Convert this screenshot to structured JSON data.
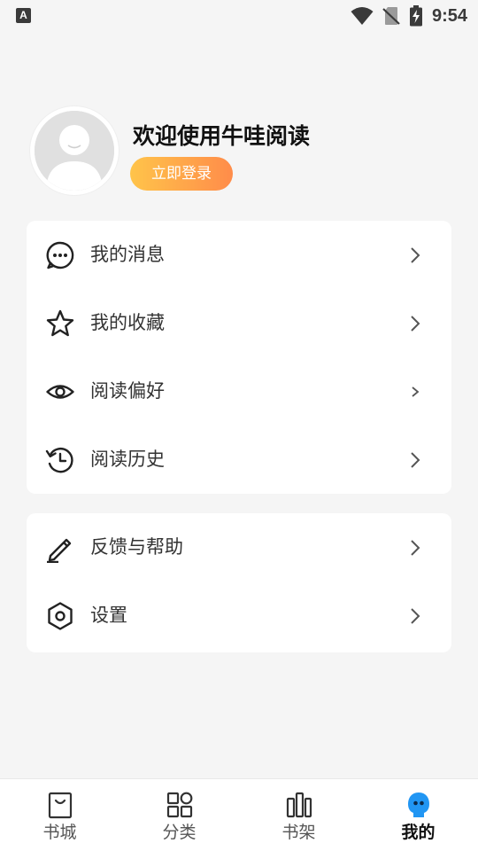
{
  "status_bar": {
    "notification_icon": "A",
    "time": "9:54",
    "icons": [
      "wifi-icon",
      "no-sim-icon",
      "battery-charging-icon"
    ]
  },
  "profile": {
    "avatar_icon": "default-avatar-icon",
    "welcome_text": "欢迎使用牛哇阅读",
    "login_label": "立即登录",
    "login_gradient": [
      "#ffc44a",
      "#ff8c4a"
    ]
  },
  "menu_group_1": [
    {
      "label": "我的消息",
      "icon": "chat-bubble-icon"
    },
    {
      "label": "我的收藏",
      "icon": "star-icon"
    },
    {
      "label": "阅读偏好",
      "icon": "eye-icon"
    },
    {
      "label": "阅读历史",
      "icon": "history-icon"
    }
  ],
  "menu_group_2": [
    {
      "label": "反馈与帮助",
      "icon": "pencil-icon"
    },
    {
      "label": "设置",
      "icon": "settings-hexagon-icon"
    }
  ],
  "bottom_nav": [
    {
      "label": "书城",
      "icon": "bookstore-icon",
      "active": false
    },
    {
      "label": "分类",
      "icon": "category-grid-icon",
      "active": false
    },
    {
      "label": "书架",
      "icon": "bookshelf-icon",
      "active": false
    },
    {
      "label": "我的",
      "icon": "profile-mascot-icon",
      "active": true
    }
  ],
  "colors": {
    "background": "#f5f5f5",
    "card": "#ffffff",
    "accent_blue": "#2196f3",
    "text_primary": "#111111",
    "text_secondary": "#333333"
  }
}
